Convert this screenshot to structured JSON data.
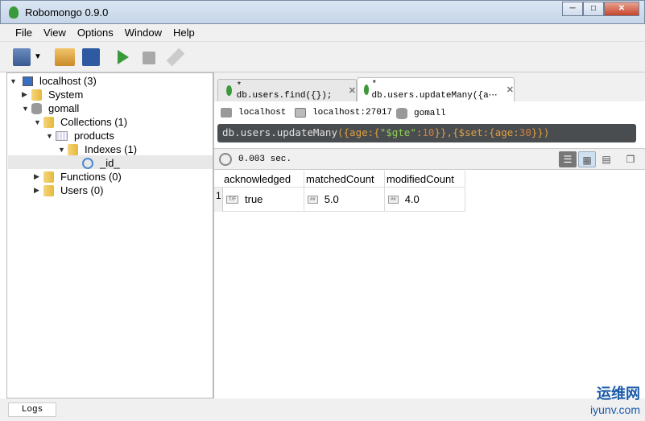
{
  "window": {
    "title": "Robomongo 0.9.0"
  },
  "menu": [
    "File",
    "View",
    "Options",
    "Window",
    "Help"
  ],
  "tree": {
    "server": "localhost (3)",
    "system": "System",
    "db": "gomall",
    "collections": "Collections (1)",
    "collection": "products",
    "indexes": "Indexes (1)",
    "index": "_id_",
    "functions": "Functions (0)",
    "users": "Users (0)"
  },
  "tabs": [
    {
      "label": "* db.users.find({});"
    },
    {
      "label": "* db.users.updateMany({a⋯",
      "active": true
    }
  ],
  "info": {
    "server": "localhost",
    "address": "localhost:27017",
    "db": "gomall"
  },
  "query": {
    "p1": "db.users.updateMany",
    "p2": "({age:{",
    "p3": "\"$gte\"",
    "p4": ":",
    "p5": "10",
    "p6": "}},{$set:{age:",
    "p7": "30",
    "p8": "}})"
  },
  "status": {
    "time": "0.003 sec."
  },
  "table": {
    "columns": [
      "acknowledged",
      "matchedCount",
      "modifiedCount"
    ],
    "row_number": "1",
    "type_tags": [
      "T/F",
      "##",
      "##"
    ],
    "values": [
      "true",
      "5.0",
      "4.0"
    ]
  },
  "bottom": {
    "logs": "Logs"
  },
  "watermark": {
    "line1": "运维网",
    "line2": "iyunv.com"
  }
}
